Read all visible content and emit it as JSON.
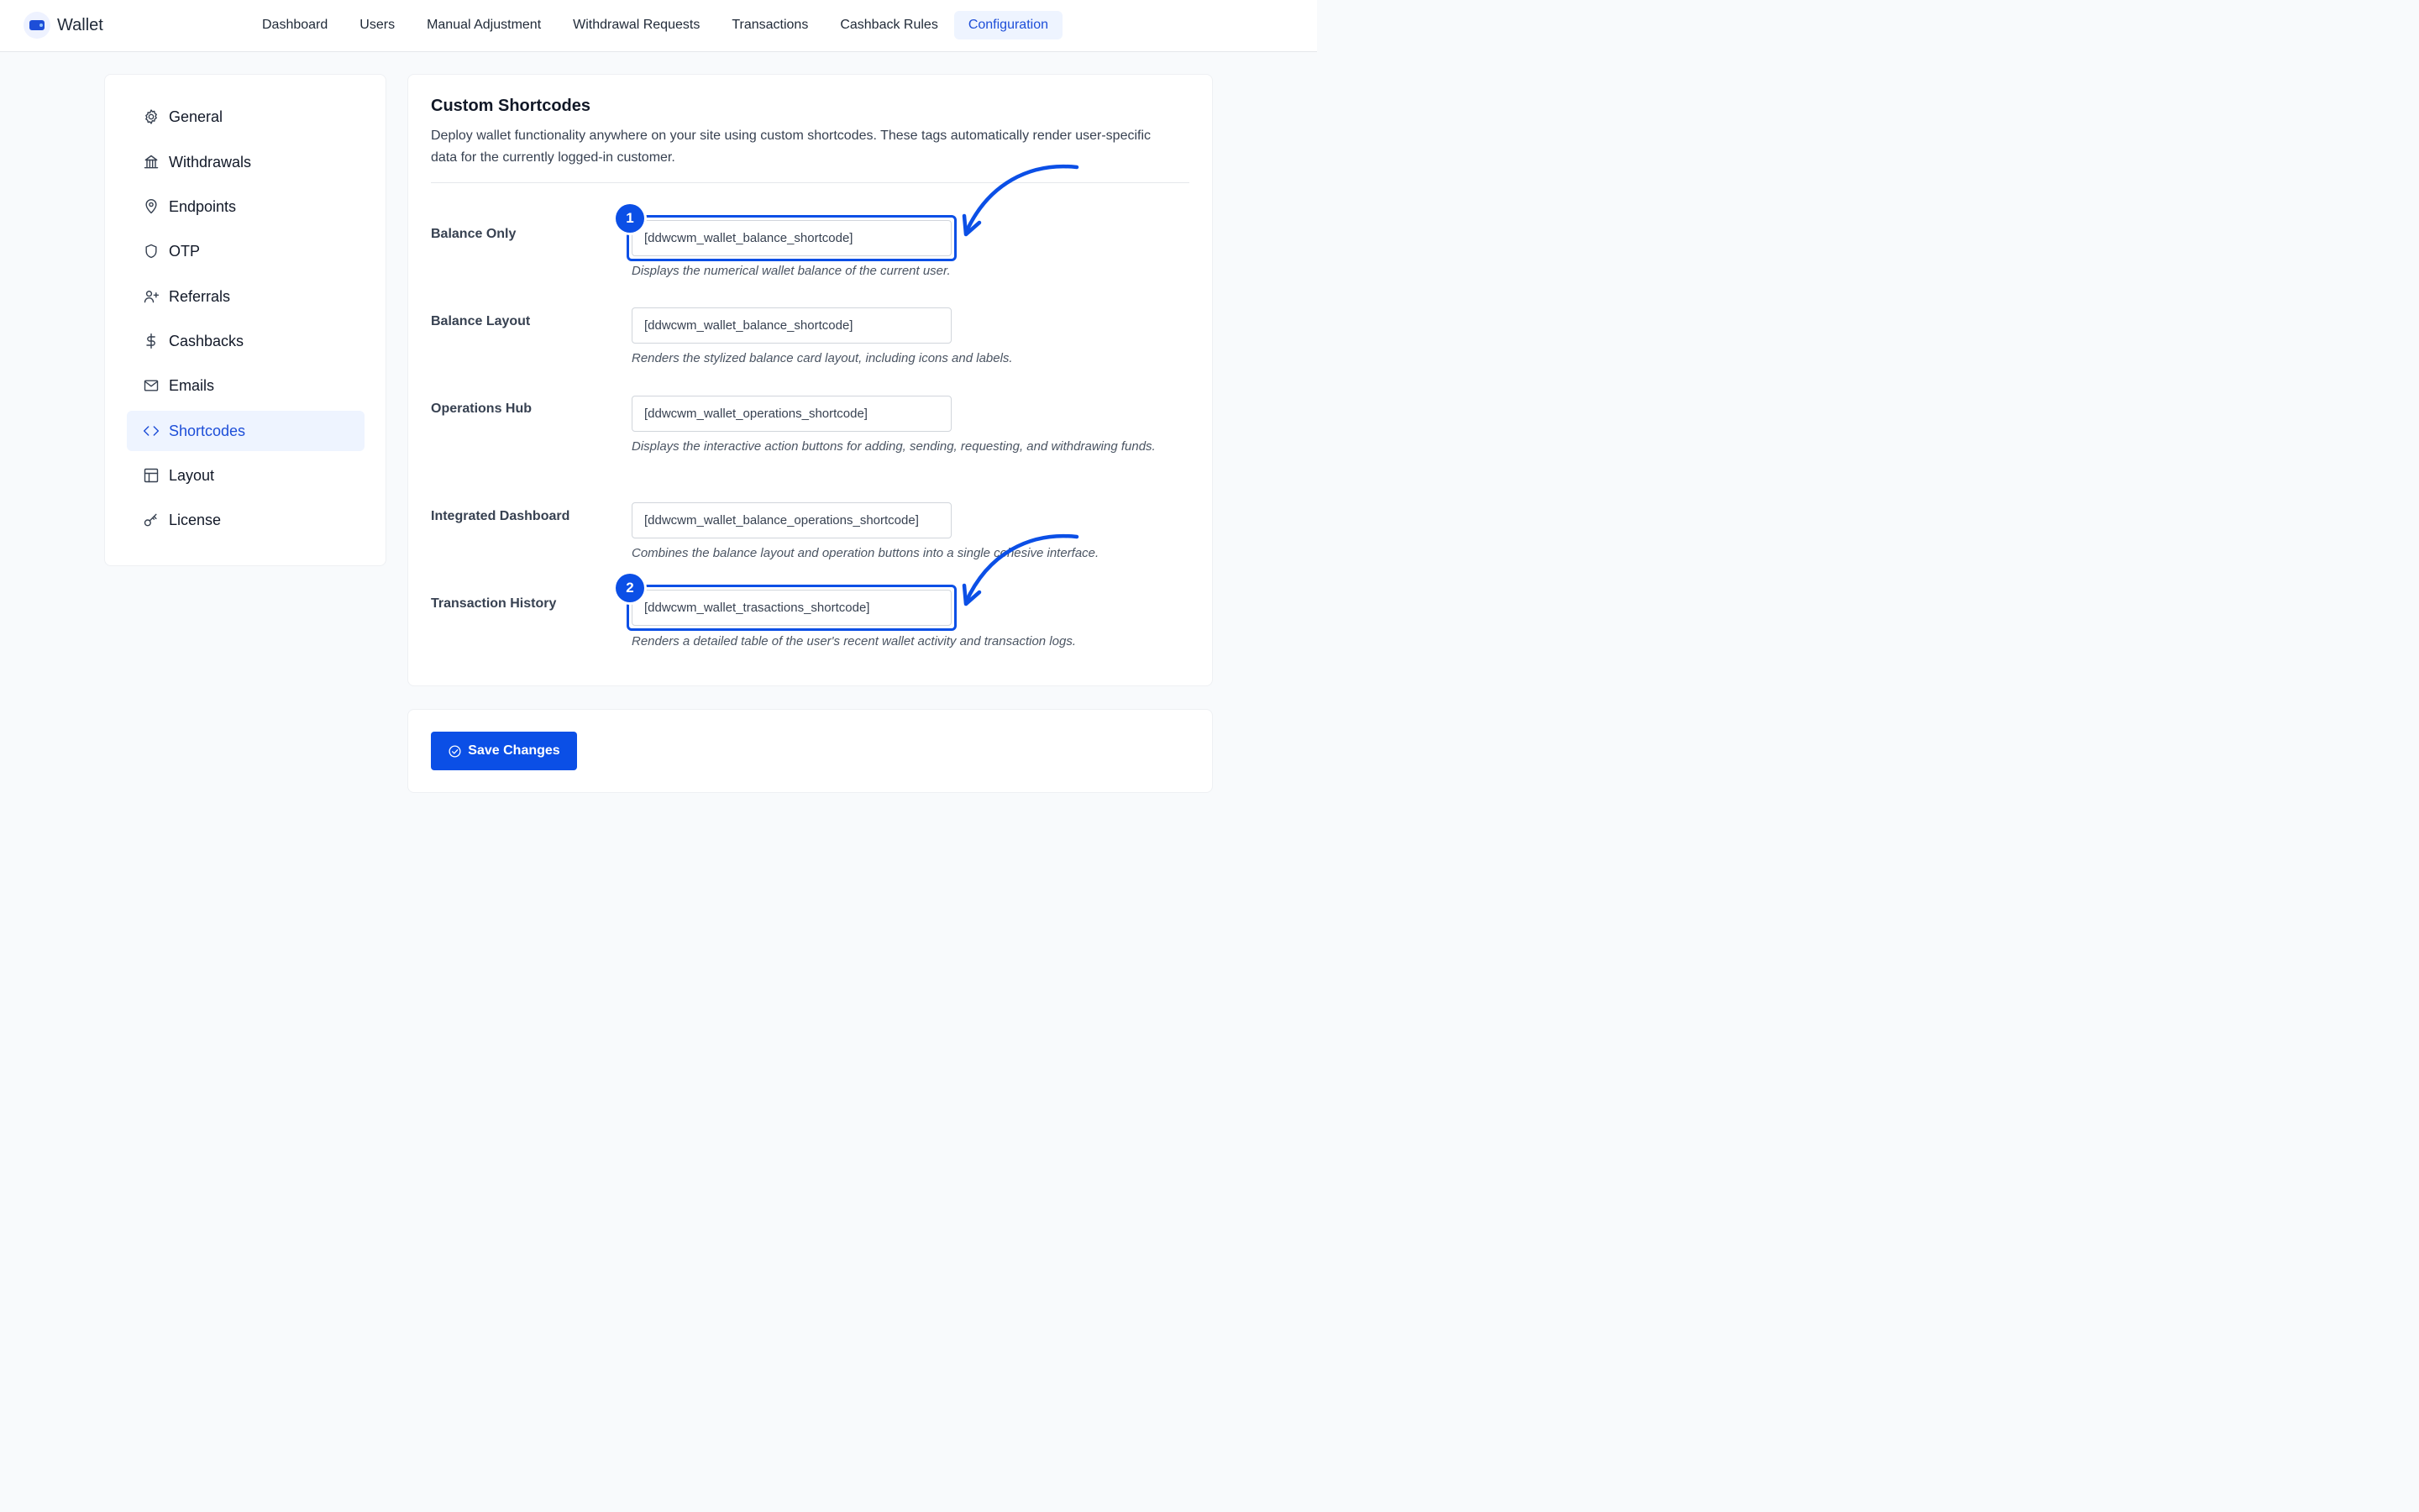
{
  "app": {
    "name": "Wallet"
  },
  "nav": [
    {
      "label": "Dashboard"
    },
    {
      "label": "Users"
    },
    {
      "label": "Manual Adjustment"
    },
    {
      "label": "Withdrawal Requests"
    },
    {
      "label": "Transactions"
    },
    {
      "label": "Cashback Rules"
    },
    {
      "label": "Configuration",
      "active": true
    }
  ],
  "sidebar": {
    "items": [
      {
        "label": "General",
        "icon": "gear-icon"
      },
      {
        "label": "Withdrawals",
        "icon": "bank-icon"
      },
      {
        "label": "Endpoints",
        "icon": "map-pin-icon"
      },
      {
        "label": "OTP",
        "icon": "shield-icon"
      },
      {
        "label": "Referrals",
        "icon": "user-plus-icon"
      },
      {
        "label": "Cashbacks",
        "icon": "dollar-icon"
      },
      {
        "label": "Emails",
        "icon": "mail-icon"
      },
      {
        "label": "Shortcodes",
        "icon": "code-icon",
        "active": true
      },
      {
        "label": "Layout",
        "icon": "layout-icon"
      },
      {
        "label": "License",
        "icon": "key-icon"
      }
    ]
  },
  "main": {
    "title": "Custom Shortcodes",
    "description": "Deploy wallet functionality anywhere on your site using custom shortcodes. These tags automatically render user-specific data for the currently logged-in customer.",
    "rows": [
      {
        "label": "Balance Only",
        "value": "[ddwcwm_wallet_balance_shortcode]",
        "hint": "Displays the numerical wallet balance of the current user.",
        "badge": "1"
      },
      {
        "label": "Balance Layout",
        "value": "[ddwcwm_wallet_balance_shortcode]",
        "hint": "Renders the stylized balance card layout, including icons and labels."
      },
      {
        "label": "Operations Hub",
        "value": "[ddwcwm_wallet_operations_shortcode]",
        "hint": "Displays the interactive action buttons for adding, sending, requesting, and withdrawing funds."
      },
      {
        "label": "Integrated Dashboard",
        "value": "[ddwcwm_wallet_balance_operations_shortcode]",
        "hint": "Combines the balance layout and operation buttons into a single cohesive interface."
      },
      {
        "label": "Transaction History",
        "value": "[ddwcwm_wallet_trasactions_shortcode]",
        "hint": "Renders a detailed table of the user's recent wallet activity and transaction logs.",
        "badge": "2"
      }
    ]
  },
  "footer": {
    "save_label": "Save Changes",
    "save_icon": "check-circle-icon"
  },
  "colors": {
    "accent": "#0b4fe6",
    "active_bg": "#eef4ff",
    "active_text": "#1d4ed8"
  }
}
